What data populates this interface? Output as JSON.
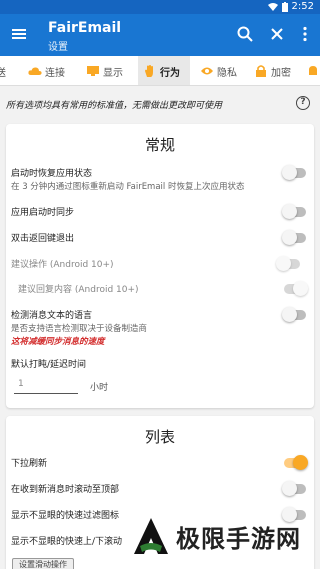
{
  "status": {
    "time": "2:52"
  },
  "appbar": {
    "title": "FairEmail",
    "subtitle": "设置"
  },
  "tabs": [
    {
      "label": "送",
      "icon": "send-icon"
    },
    {
      "label": "连接",
      "icon": "cloud-icon"
    },
    {
      "label": "显示",
      "icon": "monitor-icon"
    },
    {
      "label": "行为",
      "icon": "hand-icon",
      "active": true
    },
    {
      "label": "隐私",
      "icon": "eye-icon"
    },
    {
      "label": "加密",
      "icon": "lock-icon"
    }
  ],
  "hint": "所有选项均具有常用的标准值，无需做出更改即可使用",
  "general": {
    "title": "常规",
    "restore_state": "启动时恢复应用状态",
    "restore_state_desc": "在 3 分钟内通过图标重新启动 FairEmail 时恢复上次应用状态",
    "sync_on_launch": "应用启动时同步",
    "double_back": "双击返回键退出",
    "suggest_actions": "建议操作 (Android 10+)",
    "suggest_reply": "建议回复内容 (Android 10+)",
    "detect_language": "检测消息文本的语言",
    "detect_language_desc": "是否支持语言检测取决于设备制造商",
    "detect_language_warn": "这将减缓同步消息的速度",
    "default_snooze": "默认打盹/延迟时间",
    "snooze_value": "1",
    "snooze_unit": "小时"
  },
  "list": {
    "title": "列表",
    "pull_refresh": "下拉刷新",
    "scroll_top": "在收到新消息时滚动至顶部",
    "quick_filter": "显示不显眼的快速过滤图标",
    "quick_scroll": "显示不显眼的快速上/下滚动",
    "more_button": "设置滑动操作"
  },
  "watermark": {
    "text": "极限手游网"
  },
  "colors": {
    "primary": "#1976d2",
    "accent": "#f9a825",
    "warn": "#d32f2f"
  }
}
